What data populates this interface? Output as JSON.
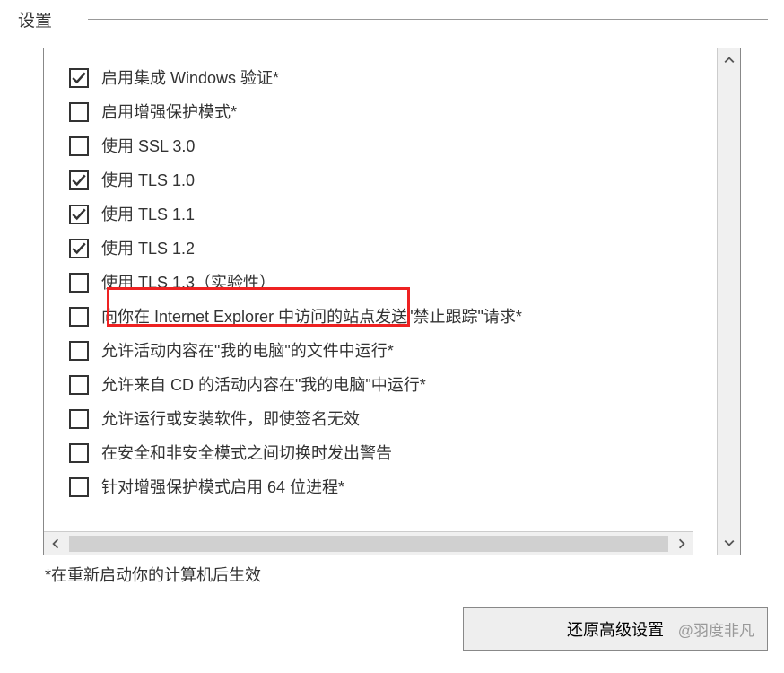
{
  "header": {
    "title": "设置"
  },
  "settings": {
    "items": [
      {
        "label": "启用集成 Windows 验证*",
        "checked": true,
        "highlighted": false
      },
      {
        "label": "启用增强保护模式*",
        "checked": false,
        "highlighted": false
      },
      {
        "label": "使用 SSL 3.0",
        "checked": false,
        "highlighted": false
      },
      {
        "label": "使用 TLS 1.0",
        "checked": true,
        "highlighted": false
      },
      {
        "label": "使用 TLS 1.1",
        "checked": true,
        "highlighted": false
      },
      {
        "label": "使用 TLS 1.2",
        "checked": true,
        "highlighted": false
      },
      {
        "label": "使用 TLS 1.3（实验性）",
        "checked": false,
        "highlighted": true
      },
      {
        "label": "向你在 Internet Explorer 中访问的站点发送\"禁止跟踪\"请求*",
        "checked": false,
        "highlighted": false
      },
      {
        "label": "允许活动内容在\"我的电脑\"的文件中运行*",
        "checked": false,
        "highlighted": false
      },
      {
        "label": "允许来自 CD 的活动内容在\"我的电脑\"中运行*",
        "checked": false,
        "highlighted": false
      },
      {
        "label": "允许运行或安装软件，即使签名无效",
        "checked": false,
        "highlighted": false
      },
      {
        "label": "在安全和非安全模式之间切换时发出警告",
        "checked": false,
        "highlighted": false
      },
      {
        "label": "针对增强保护模式启用 64 位进程*",
        "checked": false,
        "highlighted": false
      }
    ]
  },
  "footnote": "*在重新启动你的计算机后生效",
  "restoreButton": "还原高级设置",
  "watermark": "@羽度非凡"
}
